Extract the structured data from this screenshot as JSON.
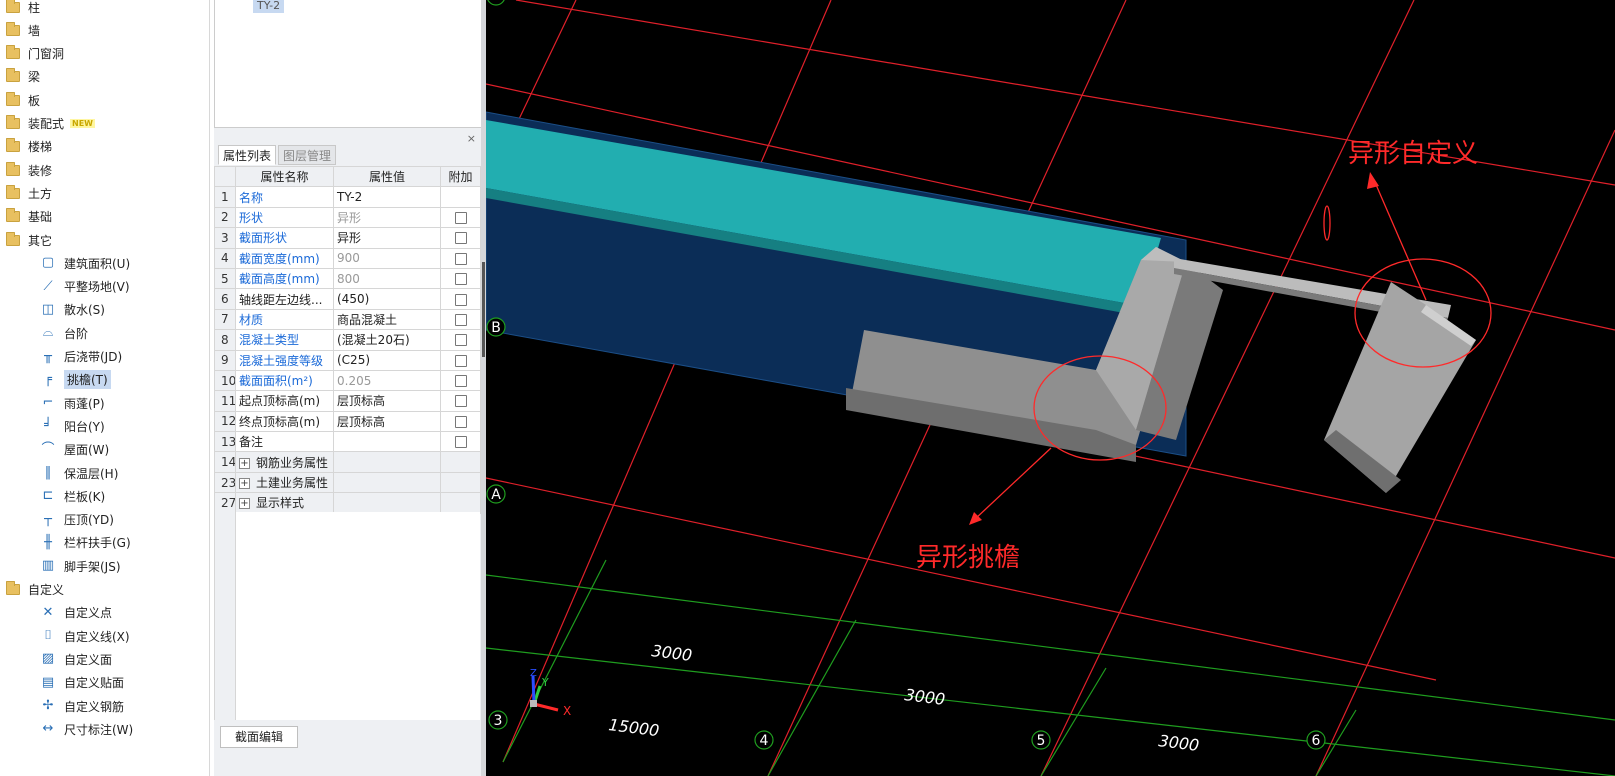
{
  "tree": {
    "categories": [
      {
        "label": "柱",
        "icon": "folder-icon"
      },
      {
        "label": "墙",
        "icon": "folder-icon"
      },
      {
        "label": "门窗洞",
        "icon": "folder-icon"
      },
      {
        "label": "梁",
        "icon": "folder-icon"
      },
      {
        "label": "板",
        "icon": "folder-icon"
      },
      {
        "label": "装配式",
        "icon": "folder-icon",
        "badge": "NEW"
      },
      {
        "label": "楼梯",
        "icon": "folder-icon"
      },
      {
        "label": "装修",
        "icon": "folder-icon"
      },
      {
        "label": "土方",
        "icon": "folder-icon"
      },
      {
        "label": "基础",
        "icon": "folder-icon"
      },
      {
        "label": "其它",
        "icon": "folder-open-icon"
      }
    ],
    "other_children": [
      {
        "label": "建筑面积(U)",
        "icon": "building-area-icon"
      },
      {
        "label": "平整场地(V)",
        "icon": "site-leveling-icon"
      },
      {
        "label": "散水(S)",
        "icon": "apron-icon"
      },
      {
        "label": "台阶",
        "icon": "steps-icon"
      },
      {
        "label": "后浇带(JD)",
        "icon": "post-cast-strip-icon"
      },
      {
        "label": "挑檐(T)",
        "icon": "cornice-icon",
        "selected": true
      },
      {
        "label": "雨蓬(P)",
        "icon": "canopy-icon"
      },
      {
        "label": "阳台(Y)",
        "icon": "balcony-icon"
      },
      {
        "label": "屋面(W)",
        "icon": "roof-icon"
      },
      {
        "label": "保温层(H)",
        "icon": "insulation-icon"
      },
      {
        "label": "栏板(K)",
        "icon": "parapet-icon"
      },
      {
        "label": "压顶(YD)",
        "icon": "coping-icon"
      },
      {
        "label": "栏杆扶手(G)",
        "icon": "railing-icon"
      },
      {
        "label": "脚手架(JS)",
        "icon": "scaffold-icon"
      }
    ],
    "custom_category": {
      "label": "自定义",
      "icon": "folder-open-icon"
    },
    "custom_children": [
      {
        "label": "自定义点",
        "icon": "custom-point-icon"
      },
      {
        "label": "自定义线(X)",
        "icon": "custom-line-icon"
      },
      {
        "label": "自定义面",
        "icon": "custom-face-icon"
      },
      {
        "label": "自定义贴面",
        "icon": "custom-facing-icon"
      },
      {
        "label": "自定义钢筋",
        "icon": "custom-rebar-icon"
      },
      {
        "label": "尺寸标注(W)",
        "icon": "dimension-icon"
      }
    ]
  },
  "component_list": {
    "selected_item": "TY-2"
  },
  "properties_panel": {
    "close_label": "×",
    "tabs": [
      "属性列表",
      "图层管理"
    ],
    "headers": {
      "name": "属性名称",
      "value": "属性值",
      "extra": "附加"
    },
    "rows": [
      {
        "num": "1",
        "name": "名称",
        "value": "TY-2",
        "blue": true,
        "gray": false,
        "checkbox": false
      },
      {
        "num": "2",
        "name": "形状",
        "value": "异形",
        "blue": true,
        "gray": true,
        "checkbox": true
      },
      {
        "num": "3",
        "name": "截面形状",
        "value": "异形",
        "blue": true,
        "gray": false,
        "checkbox": true
      },
      {
        "num": "4",
        "name": "截面宽度(mm)",
        "value": "900",
        "blue": true,
        "gray": true,
        "checkbox": true
      },
      {
        "num": "5",
        "name": "截面高度(mm)",
        "value": "800",
        "blue": true,
        "gray": true,
        "checkbox": true
      },
      {
        "num": "6",
        "name": "轴线距左边线...",
        "value": "(450)",
        "blue": false,
        "gray": false,
        "checkbox": true
      },
      {
        "num": "7",
        "name": "材质",
        "value": "商品混凝土",
        "blue": true,
        "gray": false,
        "checkbox": true
      },
      {
        "num": "8",
        "name": "混凝土类型",
        "value": "(混凝土20石)",
        "blue": true,
        "gray": false,
        "checkbox": true
      },
      {
        "num": "9",
        "name": "混凝土强度等级",
        "value": "(C25)",
        "blue": true,
        "gray": false,
        "checkbox": true
      },
      {
        "num": "10",
        "name": "截面面积(m²)",
        "value": "0.205",
        "blue": true,
        "gray": true,
        "checkbox": true
      },
      {
        "num": "11",
        "name": "起点顶标高(m)",
        "value": "层顶标高",
        "blue": false,
        "gray": false,
        "checkbox": true
      },
      {
        "num": "12",
        "name": "终点顶标高(m)",
        "value": "层顶标高",
        "blue": false,
        "gray": false,
        "checkbox": true
      },
      {
        "num": "13",
        "name": "备注",
        "value": "",
        "blue": false,
        "gray": false,
        "checkbox": true
      }
    ],
    "groups": [
      {
        "num": "14",
        "label": "钢筋业务属性"
      },
      {
        "num": "23",
        "label": "土建业务属性"
      },
      {
        "num": "27",
        "label": "显示样式"
      }
    ],
    "section_edit_button": "截面编辑"
  },
  "viewport": {
    "annotations": {
      "custom_shape": "异形自定义",
      "custom_cornice": "异形挑檐"
    },
    "axis_labels": {
      "b": "B",
      "a": "A",
      "n3": "3",
      "n4": "4",
      "n5": "5",
      "n6": "6"
    },
    "dimensions": {
      "d1": "3000",
      "d2": "3000",
      "d3": "15000",
      "d4": "3000"
    },
    "gizmo": {
      "x": "X",
      "y": "Y",
      "z": "Z"
    },
    "colors": {
      "background": "#000000",
      "grid_red": "#e0202a",
      "grid_green": "#1f9d1f",
      "beam_teal": "#22aeb0",
      "slab_navy": "#0b2d57",
      "component_gray": "#9a9a9a",
      "annotation_red": "#ff2a2a"
    }
  }
}
